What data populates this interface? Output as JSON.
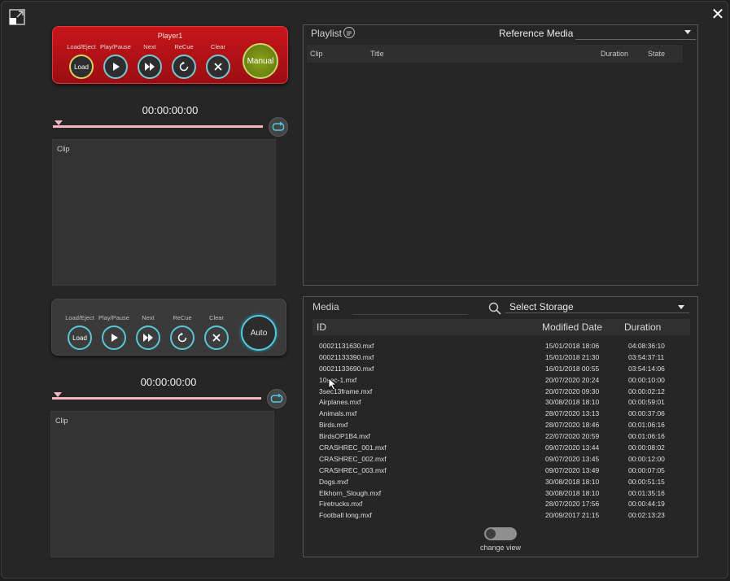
{
  "icons": {
    "expand": "expand-icon",
    "close": "close-icon",
    "search": "search-icon",
    "loop": "loop-icon"
  },
  "player1": {
    "title": "Player1",
    "controls": [
      {
        "label": "Load/Eject",
        "button_text": "Load",
        "icon": "load"
      },
      {
        "label": "Play/Pause",
        "icon": "play-icon"
      },
      {
        "label": "Next",
        "icon": "next-icon"
      },
      {
        "label": "ReCue",
        "icon": "recue-icon"
      },
      {
        "label": "Clear",
        "icon": "clear-icon"
      }
    ],
    "mode": "Manual",
    "timecode": "00:00:00:00",
    "clip_label": "Clip"
  },
  "player2": {
    "controls": [
      {
        "label": "Load/Eject",
        "button_text": "Load",
        "icon": "load"
      },
      {
        "label": "Play/Pause",
        "icon": "play-icon"
      },
      {
        "label": "Next",
        "icon": "next-icon"
      },
      {
        "label": "ReCue",
        "icon": "recue-icon"
      },
      {
        "label": "Clear",
        "icon": "clear-icon"
      }
    ],
    "mode": "Auto",
    "timecode": "00:00:00:00",
    "clip_label": "Clip"
  },
  "playlist": {
    "title": "Playlist",
    "reference_label": "Reference Media",
    "reference_value": "",
    "columns": [
      "Clip",
      "Title",
      "Duration",
      "State"
    ],
    "rows": []
  },
  "media": {
    "title": "Media",
    "storage_placeholder": "Select Storage",
    "columns": [
      "ID",
      "Modified Date",
      "Duration"
    ],
    "rows": [
      {
        "id": "00021131630.mxf",
        "date": "15/01/2018 18:06",
        "duration": "04:08:36:10"
      },
      {
        "id": "00021133390.mxf",
        "date": "15/01/2018 21:30",
        "duration": "03:54:37:11"
      },
      {
        "id": "00021133690.mxf",
        "date": "16/01/2018 00:55",
        "duration": "03:54:14:06"
      },
      {
        "id": "10sec-1.mxf",
        "date": "20/07/2020 20:24",
        "duration": "00:00:10:00"
      },
      {
        "id": "3sec13frame.mxf",
        "date": "20/07/2020 09:30",
        "duration": "00:00:02:12"
      },
      {
        "id": "Airplanes.mxf",
        "date": "30/08/2018 18:10",
        "duration": "00:00:59:01"
      },
      {
        "id": "Animals.mxf",
        "date": "28/07/2020 13:13",
        "duration": "00:00:37:06"
      },
      {
        "id": "Birds.mxf",
        "date": "28/07/2020 18:46",
        "duration": "00:01:06:16"
      },
      {
        "id": "BirdsOP1B4.mxf",
        "date": "22/07/2020 20:59",
        "duration": "00:01:06:16"
      },
      {
        "id": "CRASHREC_001.mxf",
        "date": "09/07/2020 13:44",
        "duration": "00:00:08:02"
      },
      {
        "id": "CRASHREC_002.mxf",
        "date": "09/07/2020 13:45",
        "duration": "00:00:12:00"
      },
      {
        "id": "CRASHREC_003.mxf",
        "date": "09/07/2020 13:49",
        "duration": "00:00:07:05"
      },
      {
        "id": "Dogs.mxf",
        "date": "30/08/2018 18:10",
        "duration": "00:00:51:15"
      },
      {
        "id": "Elkhorn_Slough.mxf",
        "date": "30/08/2018 18:10",
        "duration": "00:01:35:16"
      },
      {
        "id": "Firetrucks.mxf",
        "date": "28/07/2020 17:56",
        "duration": "00:00:44:19"
      },
      {
        "id": "Football long.mxf",
        "date": "20/09/2017 21:15",
        "duration": "00:02:13:23"
      }
    ],
    "change_view_label": "change view",
    "change_view_on": false
  },
  "colors": {
    "player1_bg": "#b31217",
    "accent": "#4fcbe1",
    "manual": "#7a9216",
    "scrub": "#f4b6bf"
  }
}
